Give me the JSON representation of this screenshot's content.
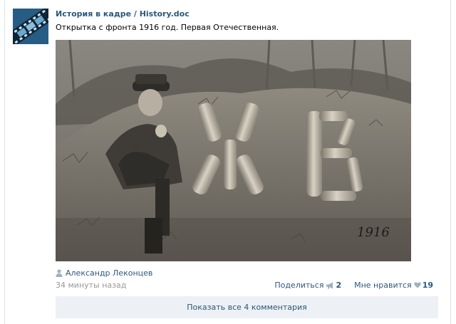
{
  "post": {
    "group_name": "История в кадре / History.doc",
    "text": "Открытка с фронта 1916 год. Первая Отечественная.",
    "photo": {
      "letters": "ЖВ",
      "year": "1916"
    },
    "author": "Александр Леконцев",
    "time": "34 минуты назад",
    "share_label": "Поделиться",
    "share_count": "2",
    "like_label": "Мне нравится",
    "like_count": "19",
    "show_comments": "Показать все 4 комментария"
  },
  "colors": {
    "link": "#2b587a",
    "muted": "#999999",
    "comments_bar": "#edf0f4"
  },
  "icons": {
    "avatar": "film-strip-avatar",
    "author": "person-icon",
    "share": "megaphone-icon",
    "like": "heart-icon"
  }
}
